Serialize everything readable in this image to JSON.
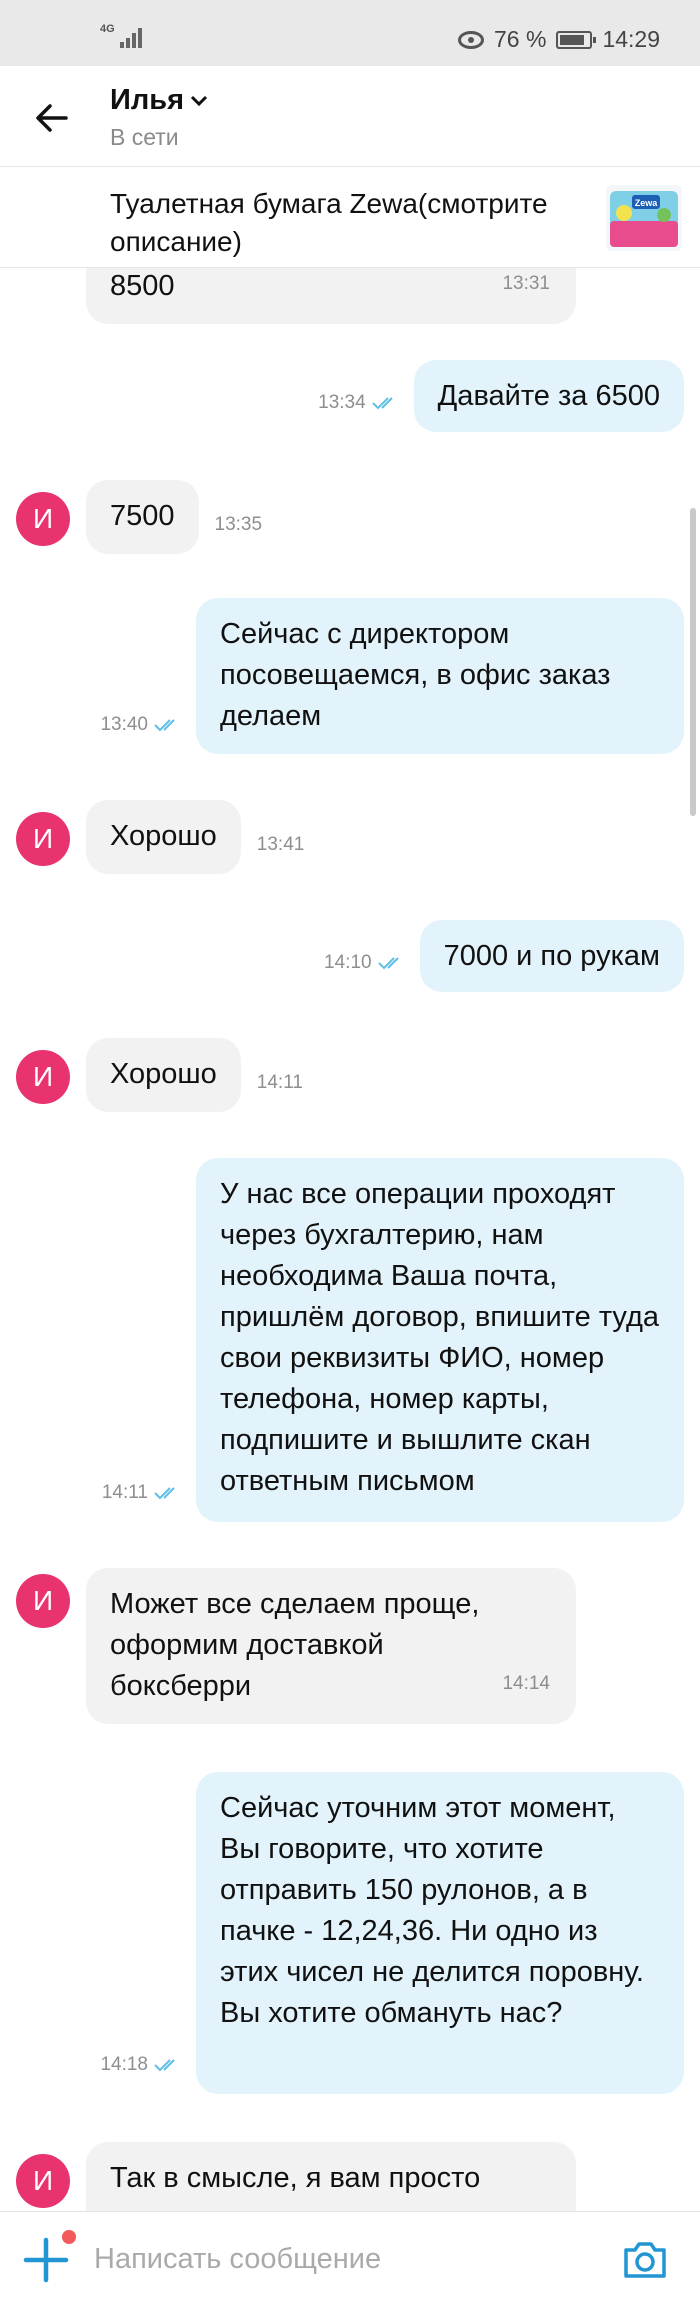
{
  "status_bar": {
    "network": "4G",
    "battery": "76 %",
    "time": "14:29",
    "icons": [
      "signal-icon",
      "eye-icon",
      "battery-icon"
    ]
  },
  "header": {
    "contact_name": "Илья",
    "contact_status": "В сети"
  },
  "product": {
    "title": "Туалетная бумага Zewa(смотрите описание)",
    "thumb_brand": "Zewa"
  },
  "chat": {
    "avatar_letter": "И",
    "messages": [
      {
        "dir": "in",
        "text": "8500",
        "time": "13:31"
      },
      {
        "dir": "out",
        "text": "Давайте за 6500",
        "time": "13:34"
      },
      {
        "dir": "in",
        "text": "7500",
        "time": "13:35"
      },
      {
        "dir": "out",
        "text": "Сейчас с директором посовещаемся, в офис заказ делаем",
        "time": "13:40"
      },
      {
        "dir": "in",
        "text": "Хорошо",
        "time": "13:41"
      },
      {
        "dir": "out",
        "text": "7000 и по рукам",
        "time": "14:10"
      },
      {
        "dir": "in",
        "text": "Хорошо",
        "time": "14:11"
      },
      {
        "dir": "out",
        "text": "У нас все операции проходят через бухгалтерию, нам необходима Ваша почта, пришлём договор, впишите туда свои реквизиты ФИО, номер телефона, номер карты, подпишите и вышлите скан ответным письмом",
        "time": "14:11"
      },
      {
        "dir": "in",
        "text": "Может все сделаем проще, оформим доставкой боксберри",
        "time": "14:14"
      },
      {
        "dir": "out",
        "text": "Сейчас уточним этот момент, Вы говорите, что хотите отправить 150 рулонов, а в пачке - 12,24,36. Ни одно из этих чисел не делится поровну. Вы хотите обмануть нас?",
        "time": "14:18"
      },
      {
        "dir": "in",
        "text": "Так в смысле, я вам просто",
        "time": ""
      }
    ]
  },
  "input": {
    "placeholder": "Написать сообщение"
  },
  "colors": {
    "accent": "#2196d3",
    "avatar": "#e8336f",
    "outgoing_bubble": "#e2f3fb",
    "incoming_bubble": "#f2f2f2",
    "notification_dot": "#f25a5a"
  }
}
